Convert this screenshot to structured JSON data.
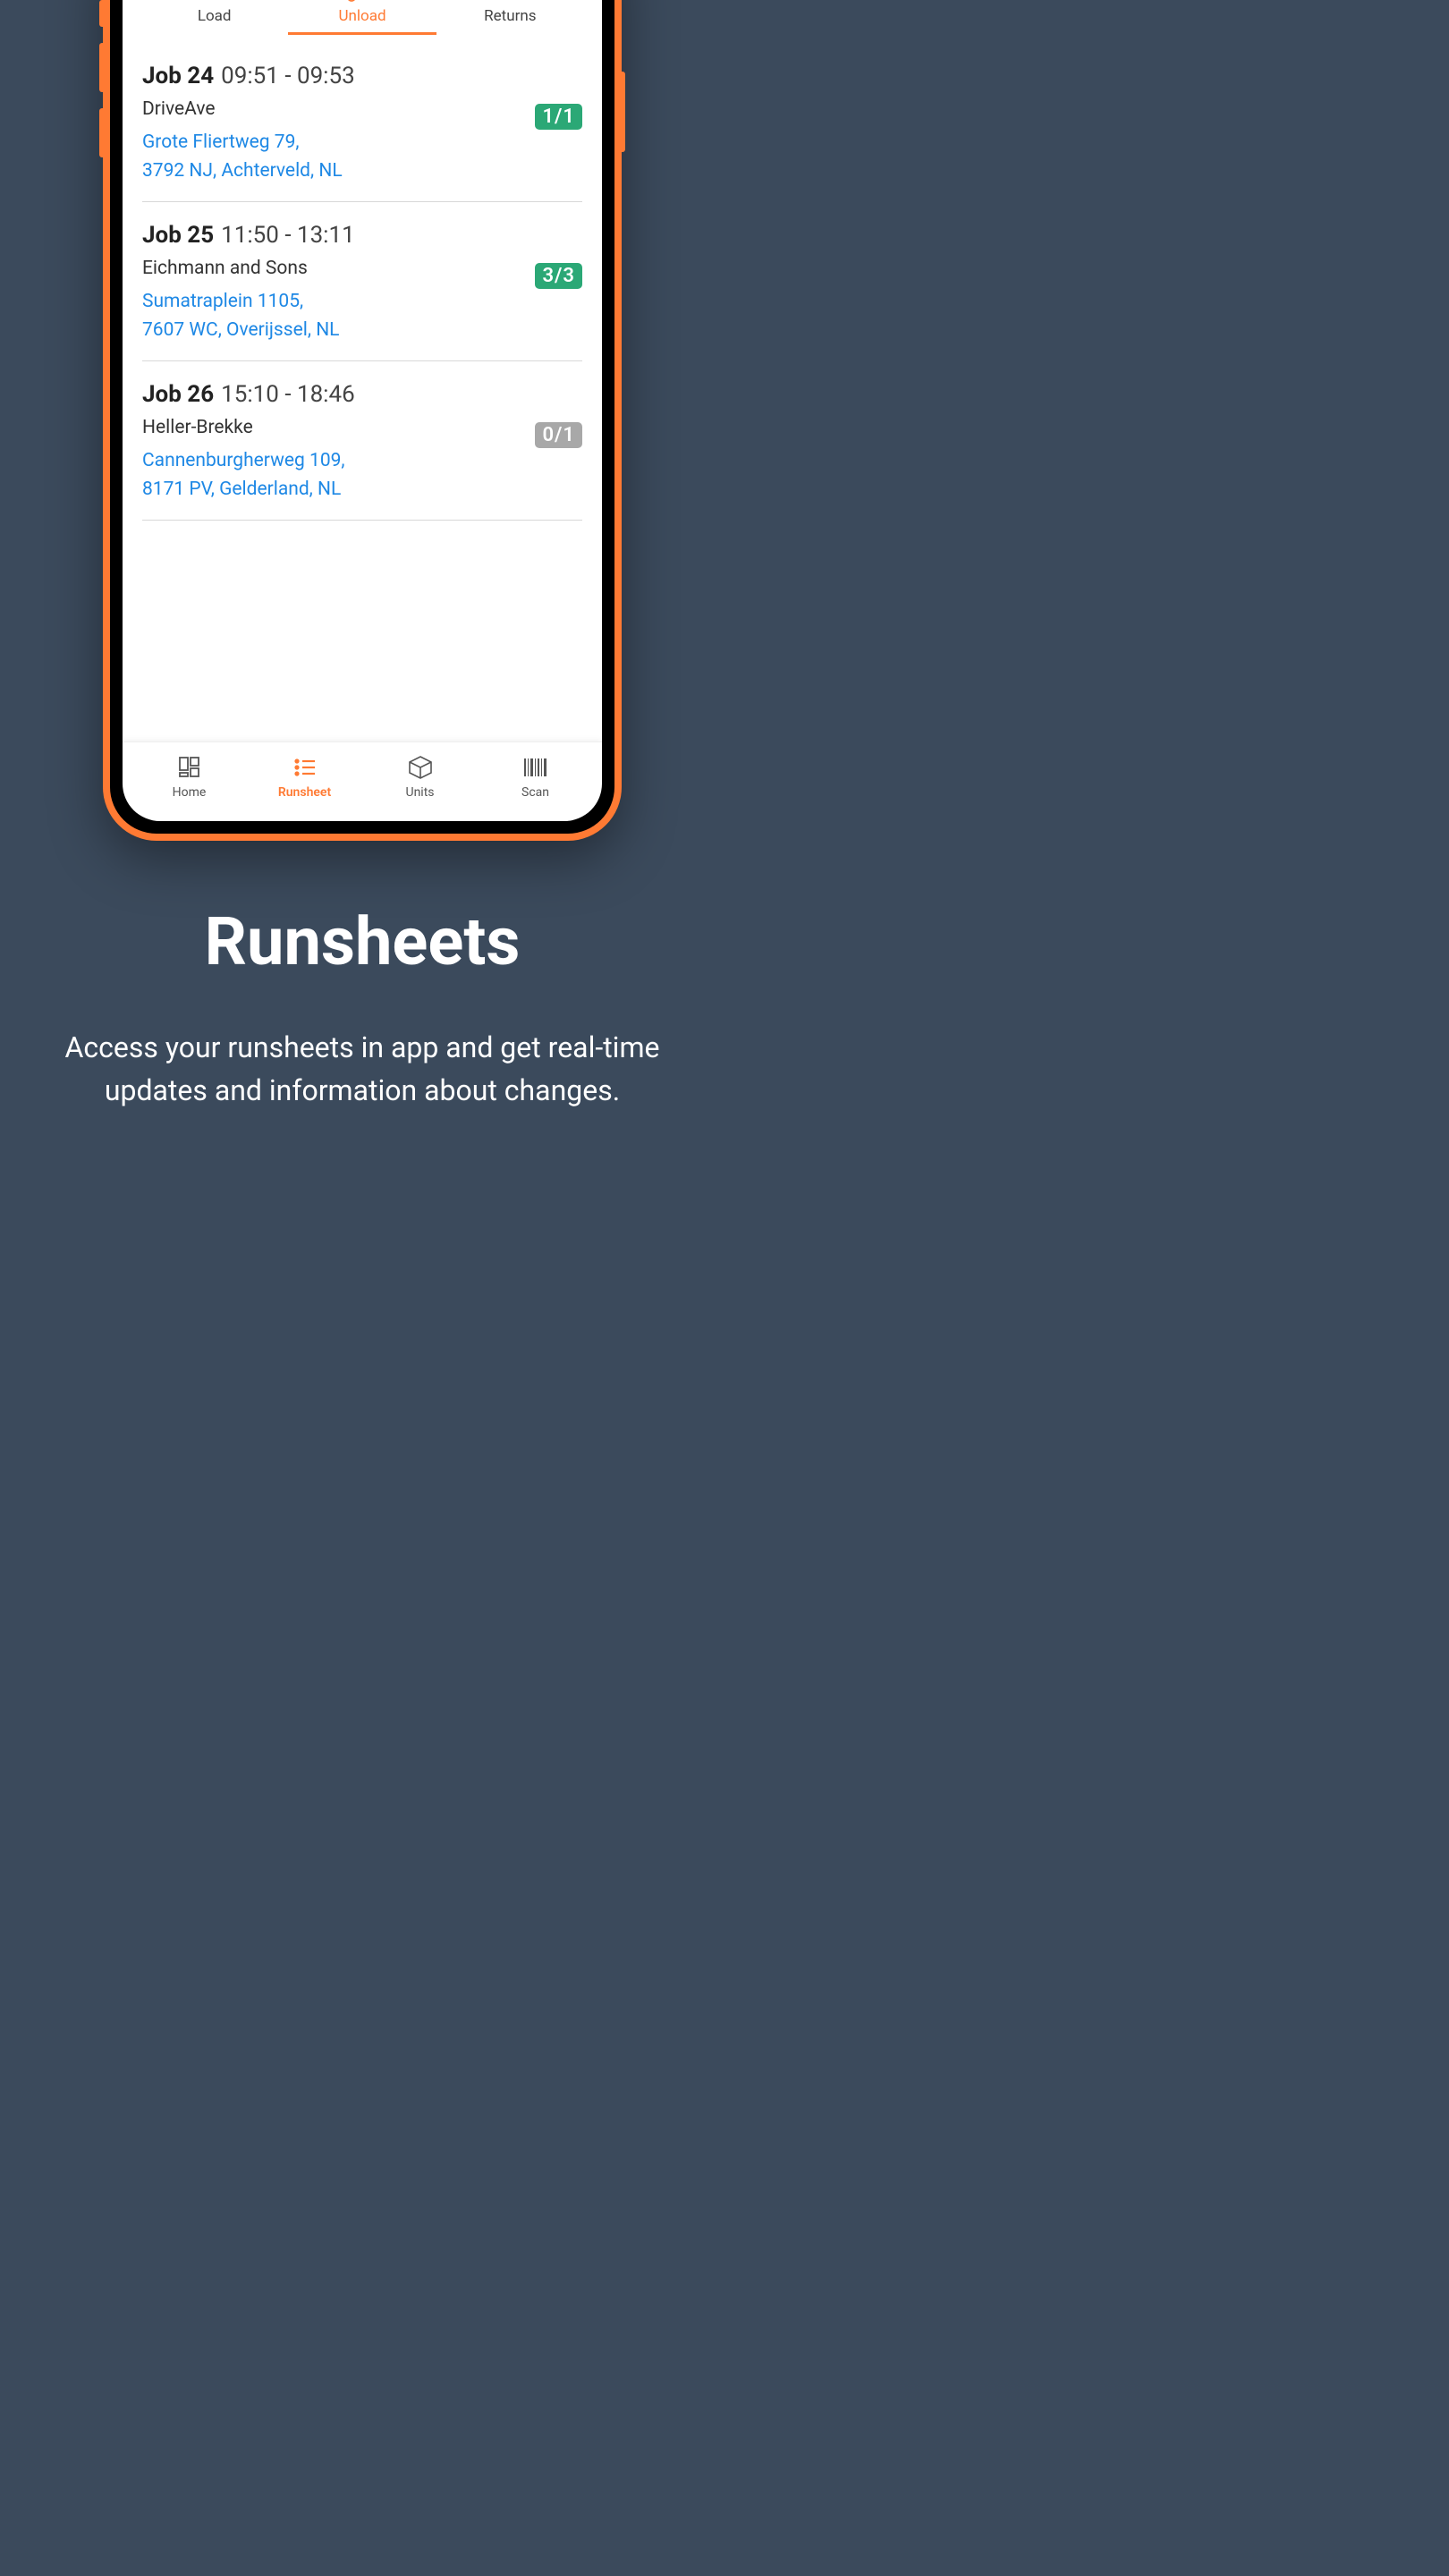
{
  "tabs": [
    {
      "label": "Load",
      "icon": "truck-load-icon"
    },
    {
      "label": "Unload",
      "icon": "dolly-icon"
    },
    {
      "label": "Returns",
      "icon": "truck-return-icon"
    }
  ],
  "activeTab": 1,
  "jobs": [
    {
      "number": "Job 24",
      "time": "09:51 - 09:53",
      "company": "DriveAve",
      "addressLine1": "Grote Fliertweg 79,",
      "addressLine2": "3792 NJ,  Achterveld, NL",
      "badge": "1/1",
      "badgeStyle": "green"
    },
    {
      "number": "Job 25",
      "time": "11:50 - 13:11",
      "company": "Eichmann and Sons",
      "addressLine1": "Sumatraplein 1105,",
      "addressLine2": "7607 WC, Overijssel, NL",
      "badge": "3/3",
      "badgeStyle": "green"
    },
    {
      "number": "Job 26",
      "time": "15:10 - 18:46",
      "company": "Heller-Brekke",
      "addressLine1": "Cannenburgherweg 109,",
      "addressLine2": "8171 PV, Gelderland, NL",
      "badge": "0/1",
      "badgeStyle": "gray"
    }
  ],
  "bottomNav": [
    {
      "label": "Home",
      "icon": "grid-icon"
    },
    {
      "label": "Runsheet",
      "icon": "list-icon"
    },
    {
      "label": "Units",
      "icon": "package-icon"
    },
    {
      "label": "Scan",
      "icon": "barcode-icon"
    }
  ],
  "activeNav": 1,
  "promo": {
    "title": "Runsheets",
    "desc": "Access your runsheets in app and get real-time updates and information about changes."
  },
  "colors": {
    "accent": "#ff7a33",
    "link": "#1e88e5",
    "badgeGreen": "#2ba876",
    "badgeGray": "#a8a8a8",
    "bg": "#3b4a5c"
  }
}
